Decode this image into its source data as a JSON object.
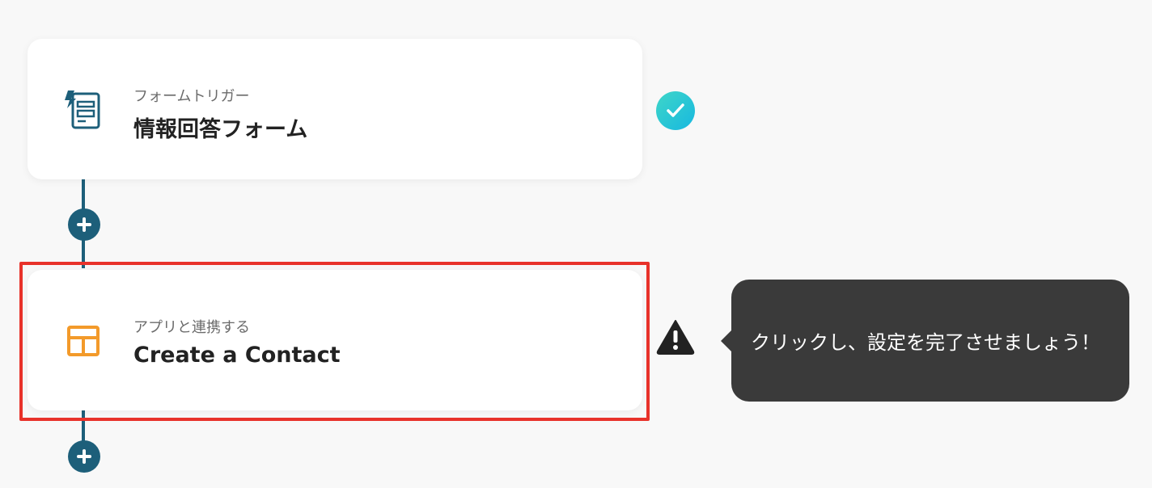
{
  "steps": [
    {
      "subtitle": "フォームトリガー",
      "title": "情報回答フォーム",
      "icon": "form-trigger-icon",
      "status": "complete"
    },
    {
      "subtitle": "アプリと連携する",
      "title": "Create a Contact",
      "icon": "app-layout-icon",
      "status": "warning"
    }
  ],
  "tooltip": {
    "text": "クリックし、設定を完了させましょう！"
  },
  "colors": {
    "connector": "#1d5f7a",
    "highlight": "#e8322a",
    "check_gradient_start": "#3fd6c8",
    "check_gradient_end": "#17b8e0",
    "form_icon": "#1d5f7a",
    "app_icon": "#f39a2a",
    "tooltip_bg": "#3a3a3a"
  }
}
